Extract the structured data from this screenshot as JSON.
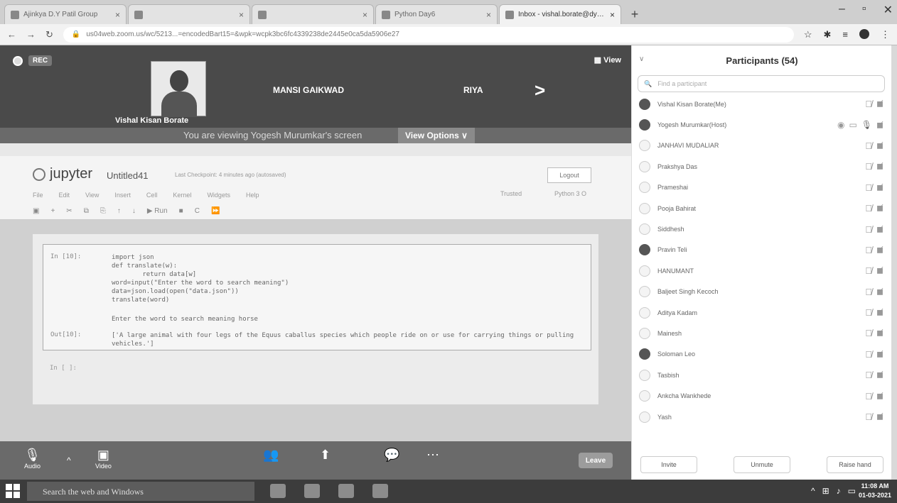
{
  "browser": {
    "tabs": [
      {
        "label": "Ajinkya D.Y Patil Group",
        "active": false
      },
      {
        "label": "",
        "active": false
      },
      {
        "label": "",
        "active": false
      },
      {
        "label": "Python Day6",
        "active": false
      },
      {
        "label": "Inbox - vishal.borate@dypic.in",
        "active": true
      }
    ],
    "new_tab": "+",
    "url": "us04web.zoom.us/wc/5213...=encodedBart15=&wpk=wcpk3bc6fc4339238de2445e0ca5da5906e27"
  },
  "zoom": {
    "rec_label": "REC",
    "view_label": "View",
    "gallery_names": [
      "Vishal Kisan Borate",
      "MANSI GAIKWAD",
      "RIYA"
    ],
    "next_arrow": ">",
    "share_banner": "You are viewing Yogesh Murumkar's screen",
    "view_options": "View Options ∨",
    "controls": {
      "audio": "Audio",
      "video": "Video",
      "leave": "Leave"
    }
  },
  "jupyter": {
    "logo": "jupyter",
    "title": "Untitled41",
    "checkpoint": "Last Checkpoint: 4 minutes ago (autosaved)",
    "logout": "Logout",
    "menu": [
      "File",
      "Edit",
      "View",
      "Insert",
      "Cell",
      "Kernel",
      "Widgets",
      "Help"
    ],
    "trusted": "Trusted",
    "kernel": "Python 3 O",
    "toolbar": [
      "▣",
      "+",
      "✂",
      "⧉",
      "⎘",
      "↑",
      "↓",
      "▶ Run",
      "■",
      "C",
      "⏩"
    ],
    "cell": {
      "prompt": "In [10]:",
      "code": "import json\ndef translate(w):\n        return data[w]\nword=input(\"Enter the word to search meaning\")\ndata=json.load(open(\"data.json\"))\ntranslate(word)",
      "stdin": "Enter the word to search meaning horse",
      "out_prompt": "Out[10]:",
      "output": "['A large animal with four legs of the Equus caballus species which people ride on or use for carrying things or pulling vehicles.']"
    },
    "empty_prompt": "In [ ]:"
  },
  "participants": {
    "title": "Participants (54)",
    "search_placeholder": "Find a participant",
    "list": [
      {
        "name": "Vishal Kisan Borate(Me)",
        "avatar": "dark"
      },
      {
        "name": "Yogesh Murumkar(Host)",
        "avatar": "dark"
      },
      {
        "name": "JANHAVI MUDALIAR",
        "avatar": "light"
      },
      {
        "name": "Prakshya Das",
        "avatar": "light"
      },
      {
        "name": "Prameshai",
        "avatar": "light"
      },
      {
        "name": "Pooja Bahirat",
        "avatar": "light"
      },
      {
        "name": "Siddhesh",
        "avatar": "light"
      },
      {
        "name": "Pravin Teli",
        "avatar": "dark"
      },
      {
        "name": "HANUMANT",
        "avatar": "light"
      },
      {
        "name": "Baljeet Singh Kecoch",
        "avatar": "light"
      },
      {
        "name": "Aditya Kadam",
        "avatar": "light"
      },
      {
        "name": "Mainesh",
        "avatar": "light"
      },
      {
        "name": "Soloman Leo",
        "avatar": "dark"
      },
      {
        "name": "Tasbish",
        "avatar": "light"
      },
      {
        "name": "Ankcha Wankhede",
        "avatar": "light"
      },
      {
        "name": "Yash",
        "avatar": "light"
      }
    ],
    "invite": "Invite",
    "unmute": "Unmute",
    "raise_hand": "Raise hand"
  },
  "taskbar": {
    "search": "Search the web and Windows",
    "time": "11:08 AM",
    "date": "01-03-2021"
  },
  "colors": {
    "zoom_dark": "#4a4a4a",
    "panel_bg": "#ffffff",
    "taskbar": "#3c3c3c"
  }
}
